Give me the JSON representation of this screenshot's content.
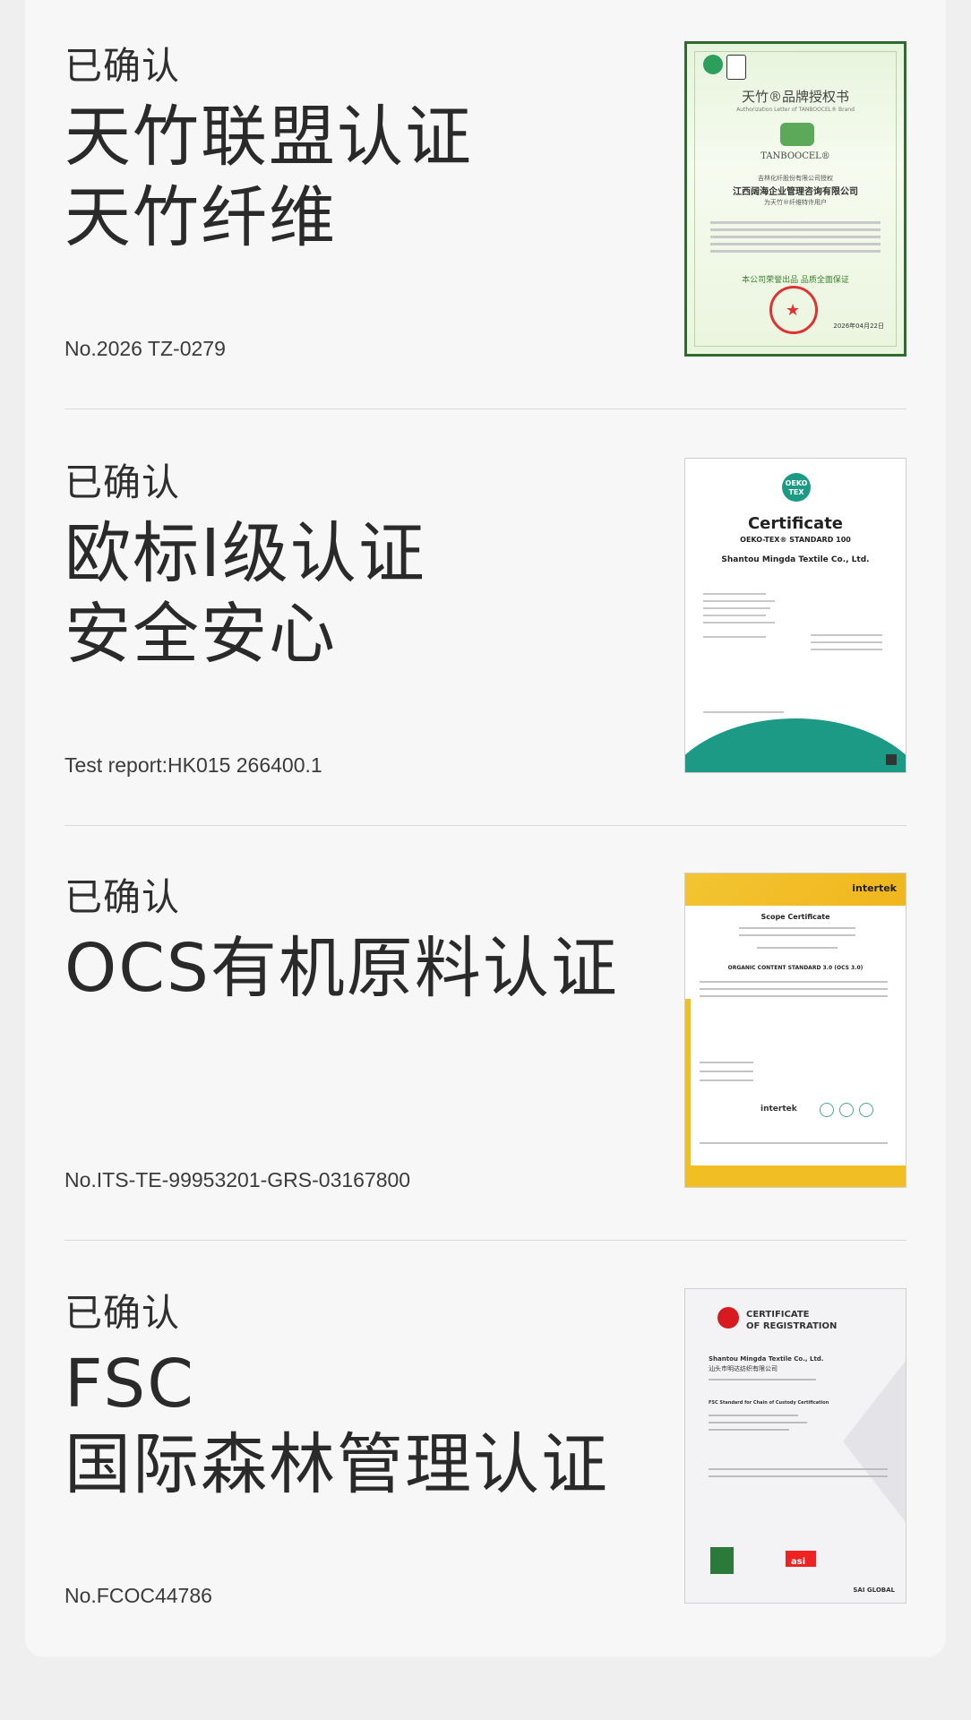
{
  "sections": [
    {
      "confirm": "已确认",
      "title_lines": [
        "天竹联盟认证",
        "天竹纤维"
      ],
      "number": "No.2026 TZ-0279",
      "cert": {
        "title": "天竹®品牌授权书",
        "subtitle": "Authorization Letter of TANBOOCEL® Brand",
        "brand": "TANBOOCEL®",
        "issuer": "吉林化纤股份有限公司授权",
        "company": "江西阔海企业管理咨询有限公司",
        "role": "为天竹®纤维特许用户",
        "footer": "本公司荣誉出品 品质全面保证",
        "date": "2026年04月22日"
      }
    },
    {
      "confirm": "已确认",
      "title_lines": [
        "欧标I级认证",
        "安全安心"
      ],
      "number": "Test report:HK015 266400.1",
      "cert": {
        "logo": "OEKO TEX",
        "title": "Certificate",
        "standard": "OEKO-TEX® STANDARD 100",
        "company": "Shantou Mingda Textile Co., Ltd."
      }
    },
    {
      "confirm": "已确认",
      "title_lines": [
        "OCS有机原料认证"
      ],
      "number": "No.ITS-TE-99953201-GRS-03167800",
      "cert": {
        "brand": "intertek",
        "title": "Scope Certificate",
        "standard": "ORGANIC CONTENT STANDARD 3.0 (OCS 3.0)",
        "mark": "intertek"
      }
    },
    {
      "confirm": "已确认",
      "title_lines": [
        "FSC",
        "国际森林管理认证"
      ],
      "number": "No.FCOC44786",
      "cert": {
        "title_1": "CERTIFICATE",
        "title_2": "OF REGISTRATION",
        "company": "Shantou Mingda Textile Co., Ltd.",
        "company_cn": "汕头市明达纺织有限公司",
        "standard": "FSC Standard for Chain of Custody Certification",
        "asi": "asi",
        "sai": "SAI GLOBAL"
      }
    }
  ]
}
